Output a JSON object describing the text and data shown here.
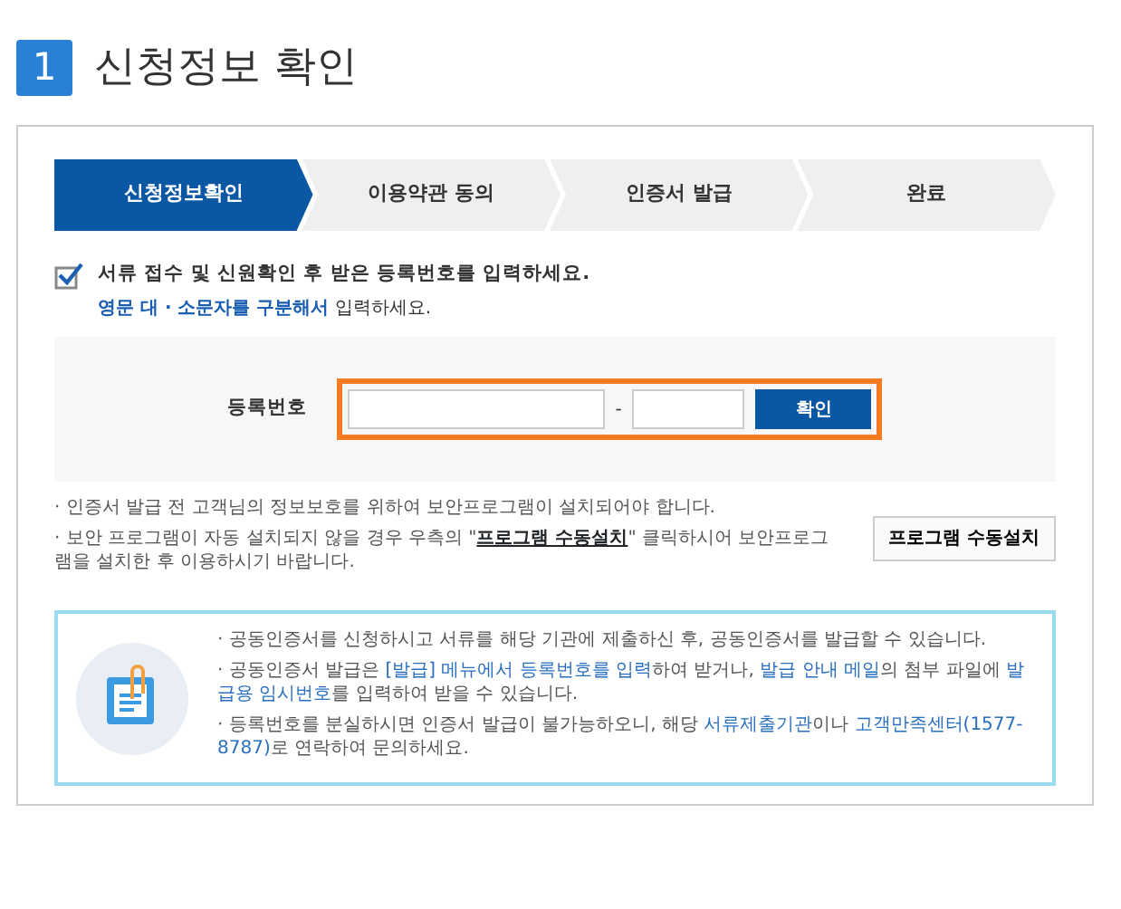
{
  "heading": {
    "number": "1",
    "title": "신청정보 확인"
  },
  "steps": [
    {
      "label": "신청정보확인",
      "selected": true
    },
    {
      "label": "이용약관 동의",
      "selected": false
    },
    {
      "label": "인증서 발급",
      "selected": false
    },
    {
      "label": "완료",
      "selected": false
    }
  ],
  "instruction": {
    "checked": true,
    "text": "서류 접수 및 신원확인 후 받은 등록번호를 입력하세요.",
    "hint": [
      {
        "text": "영문 대 · 소문자를 구분해서",
        "emphasis": true
      },
      {
        "text": " 입력하세요.",
        "emphasis": false
      }
    ]
  },
  "form": {
    "label": "등록번호",
    "separator": "-",
    "button": "확인"
  },
  "notes": [
    [
      {
        "text": "· 인증서 발급 전 고객님의 정보보호를 위하여 보안프로그램이 설치되어야 합니다.",
        "emphasis": false
      }
    ],
    [
      {
        "text": "· 보안 프로그램이 자동 설치되지 않을 경우 우측의 \"",
        "emphasis": false
      },
      {
        "text": "프로그램 수동설치",
        "emphasis": true
      },
      {
        "text": "\" 클릭하시어 보안프로그램을 설치한 후 이용하시기 바랍니다.",
        "emphasis": false
      }
    ]
  ],
  "install_button": "프로그램 수동설치",
  "info": [
    [
      {
        "text": "· 공동인증서를 신청하시고 서류를 해당 기관에 제출하신 후, 공동인증서를 발급할 수 있습니다.",
        "emphasis": false
      }
    ],
    [
      {
        "text": "· 공동인증서 발급은 ",
        "emphasis": false
      },
      {
        "text": "[발급] 메뉴에서 등록번호를 입력",
        "emphasis": true
      },
      {
        "text": "하여 받거나, ",
        "emphasis": false
      },
      {
        "text": "발급 안내 메일",
        "emphasis": true
      },
      {
        "text": "의 첨부 파일에 ",
        "emphasis": false
      },
      {
        "text": "발급용 임시번호",
        "emphasis": true
      },
      {
        "text": "를 입력하여 받을 수 있습니다.",
        "emphasis": false
      }
    ],
    [
      {
        "text": "· 등록번호를 분실하시면 인증서 발급이 불가능하오니, 해당 ",
        "emphasis": false
      },
      {
        "text": "서류제출기관",
        "emphasis": true
      },
      {
        "text": "이나 ",
        "emphasis": false
      },
      {
        "text": "고객만족센터(1577-8787)",
        "emphasis": true
      },
      {
        "text": "로 연락하여 문의하세요.",
        "emphasis": false
      }
    ]
  ]
}
